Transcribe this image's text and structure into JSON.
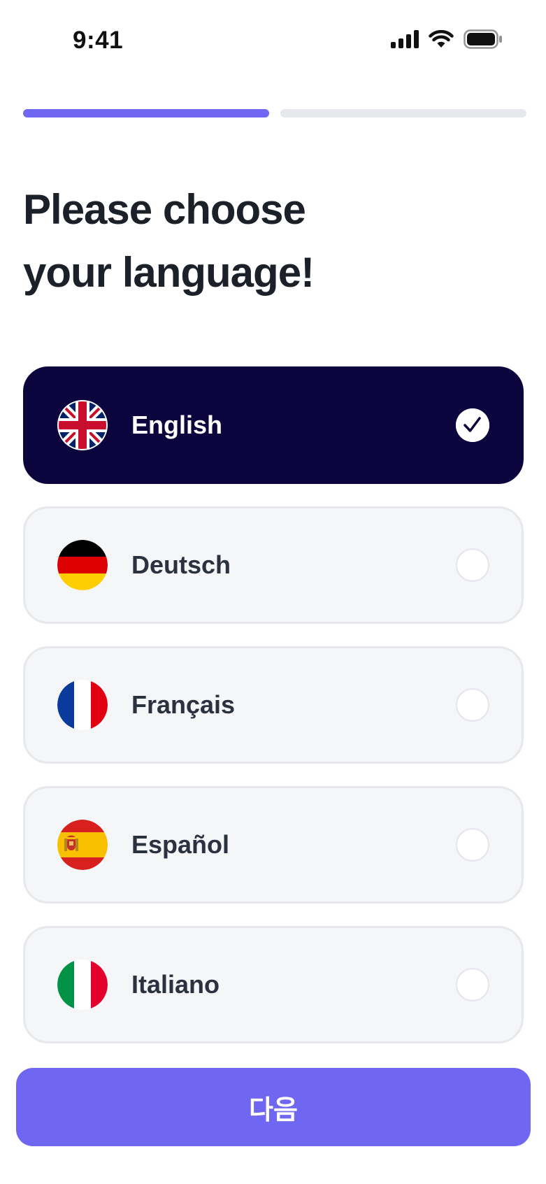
{
  "status_bar": {
    "time": "9:41",
    "icons": [
      "cellular-signal-icon",
      "wifi-icon",
      "battery-icon"
    ]
  },
  "progress": {
    "total_steps": 2,
    "current_step": 1,
    "active_color": "#6f66f2"
  },
  "header": {
    "title_line1": "Please choose",
    "title_line2": "your language!"
  },
  "languages": [
    {
      "label": "English",
      "flag": "uk-flag-icon",
      "selected": true
    },
    {
      "label": "Deutsch",
      "flag": "german-flag-icon",
      "selected": false
    },
    {
      "label": "Français",
      "flag": "french-flag-icon",
      "selected": false
    },
    {
      "label": "Español",
      "flag": "spanish-flag-icon",
      "selected": false
    },
    {
      "label": "Italiano",
      "flag": "italian-flag-icon",
      "selected": false
    }
  ],
  "footer": {
    "next_label": "다음"
  },
  "colors": {
    "accent": "#6f66f2",
    "selected_background": "#0c043d",
    "option_background": "#f5f6f8"
  }
}
